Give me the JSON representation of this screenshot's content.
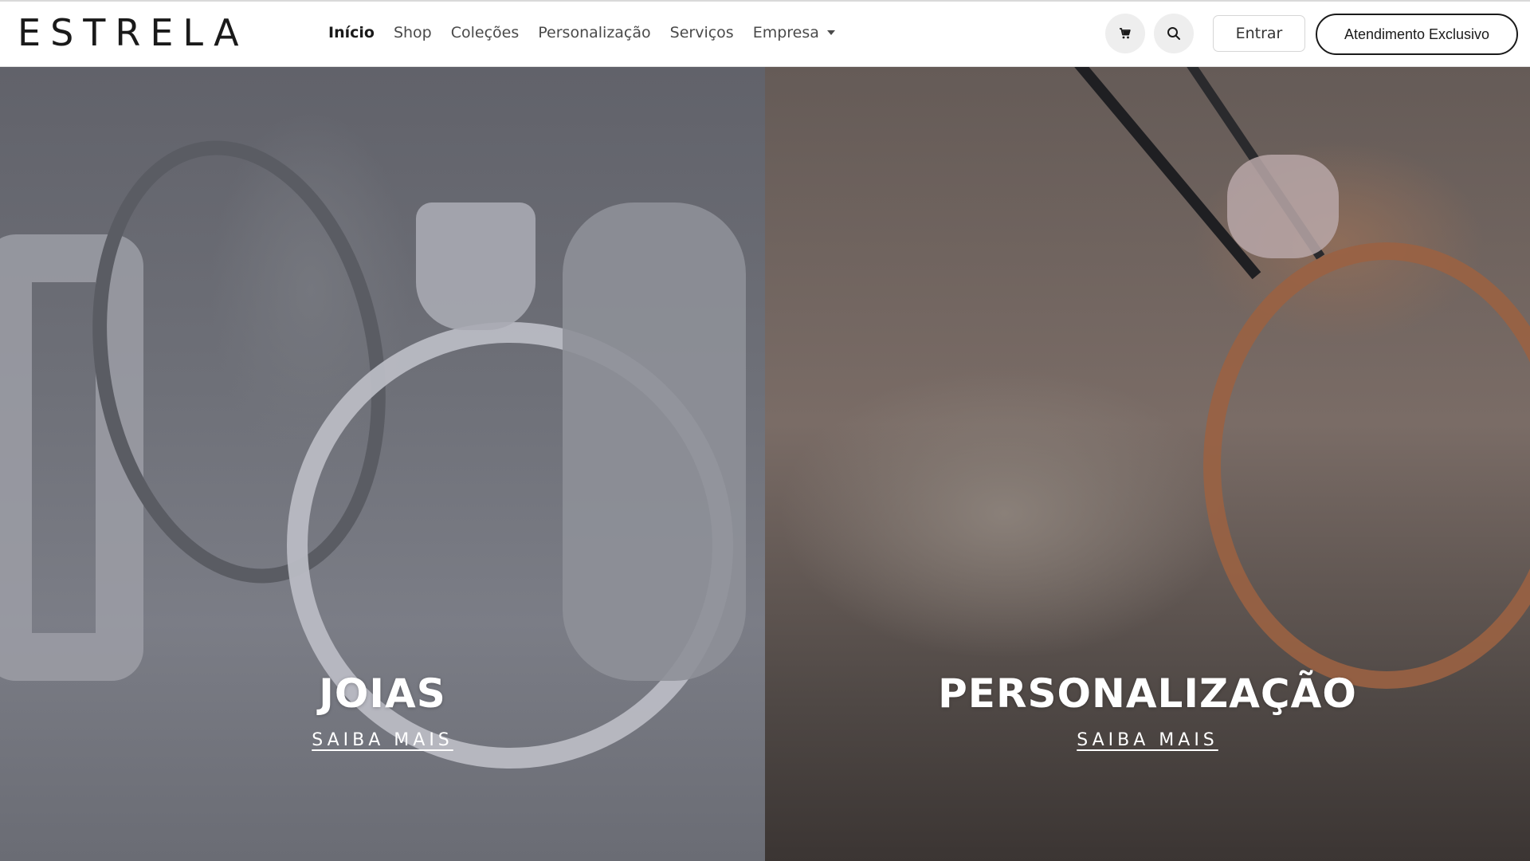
{
  "brand": {
    "logo": "ESTRELA"
  },
  "nav": {
    "items": [
      {
        "label": "Início",
        "active": true
      },
      {
        "label": "Shop"
      },
      {
        "label": "Coleções"
      },
      {
        "label": "Personalização"
      },
      {
        "label": "Serviços"
      },
      {
        "label": "Empresa",
        "has_dropdown": true
      }
    ]
  },
  "actions": {
    "cart_icon": "cart-icon",
    "search_icon": "search-icon",
    "login_label": "Entrar",
    "exclusive_label": "Atendimento Exclusivo"
  },
  "hero": {
    "left": {
      "title": "JOIAS",
      "link": "SAIBA MAIS"
    },
    "right": {
      "title": "PERSONALIZAÇÃO",
      "link": "SAIBA MAIS"
    }
  },
  "colors": {
    "text_dark": "#1a1a1a",
    "nav_text": "#4a4a4a",
    "overlay_text": "#ffffff"
  }
}
